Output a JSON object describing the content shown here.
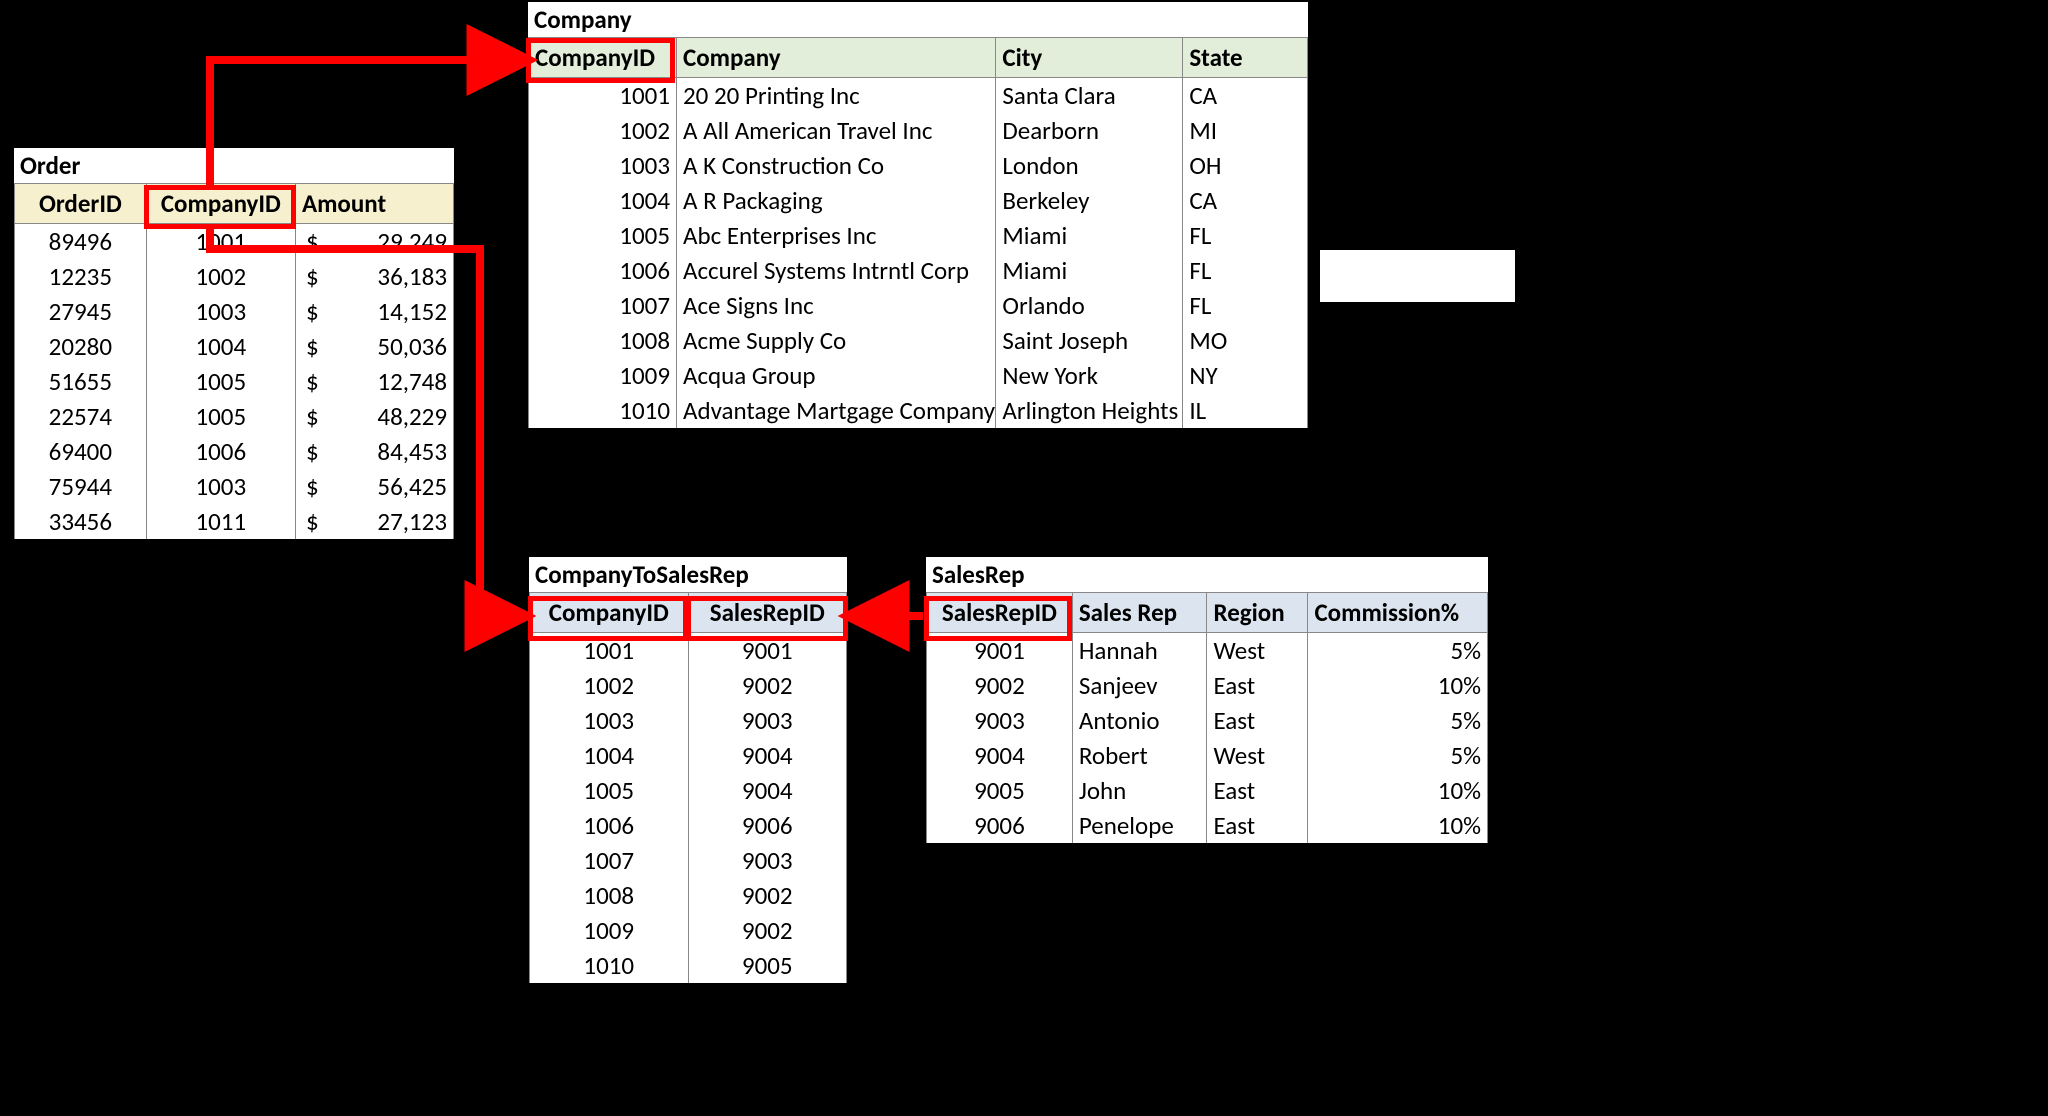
{
  "order": {
    "title": "Order",
    "headers": [
      "OrderID",
      "CompanyID",
      "Amount"
    ],
    "rows": [
      [
        "89496",
        "1001",
        "$",
        "29,249"
      ],
      [
        "12235",
        "1002",
        "$",
        "36,183"
      ],
      [
        "27945",
        "1003",
        "$",
        "14,152"
      ],
      [
        "20280",
        "1004",
        "$",
        "50,036"
      ],
      [
        "51655",
        "1005",
        "$",
        "12,748"
      ],
      [
        "22574",
        "1005",
        "$",
        "48,229"
      ],
      [
        "69400",
        "1006",
        "$",
        "84,453"
      ],
      [
        "75944",
        "1003",
        "$",
        "56,425"
      ],
      [
        "33456",
        "1011",
        "$",
        "27,123"
      ]
    ]
  },
  "company": {
    "title": "Company",
    "headers": [
      "CompanyID",
      "Company",
      "City",
      "State"
    ],
    "rows": [
      [
        "1001",
        "20 20 Printing Inc",
        "Santa Clara",
        "CA"
      ],
      [
        "1002",
        "A All American Travel Inc",
        "Dearborn",
        "MI"
      ],
      [
        "1003",
        "A K Construction Co",
        "London",
        "OH"
      ],
      [
        "1004",
        "A R Packaging",
        "Berkeley",
        "CA"
      ],
      [
        "1005",
        "Abc Enterprises Inc",
        "Miami",
        "FL"
      ],
      [
        "1006",
        "Accurel Systems Intrntl Corp",
        "Miami",
        "FL"
      ],
      [
        "1007",
        "Ace Signs Inc",
        "Orlando",
        "FL"
      ],
      [
        "1008",
        "Acme Supply Co",
        "Saint Joseph",
        "MO"
      ],
      [
        "1009",
        "Acqua Group",
        "New York",
        "NY"
      ],
      [
        "1010",
        "Advantage Martgage Company",
        "Arlington Heights",
        "IL"
      ]
    ]
  },
  "c2sr": {
    "title": "CompanyToSalesRep",
    "headers": [
      "CompanyID",
      "SalesRepID"
    ],
    "rows": [
      [
        "1001",
        "9001"
      ],
      [
        "1002",
        "9002"
      ],
      [
        "1003",
        "9003"
      ],
      [
        "1004",
        "9004"
      ],
      [
        "1005",
        "9004"
      ],
      [
        "1006",
        "9006"
      ],
      [
        "1007",
        "9003"
      ],
      [
        "1008",
        "9002"
      ],
      [
        "1009",
        "9002"
      ],
      [
        "1010",
        "9005"
      ]
    ]
  },
  "salesrep": {
    "title": "SalesRep",
    "headers": [
      "SalesRepID",
      "Sales Rep",
      "Region",
      "Commission%"
    ],
    "rows": [
      [
        "9001",
        "Hannah",
        "West",
        "5%"
      ],
      [
        "9002",
        "Sanjeev",
        "East",
        "10%"
      ],
      [
        "9003",
        "Antonio",
        "East",
        "5%"
      ],
      [
        "9004",
        "Robert",
        "West",
        "5%"
      ],
      [
        "9005",
        "John",
        "East",
        "10%"
      ],
      [
        "9006",
        "Penelope",
        "East",
        "10%"
      ]
    ]
  }
}
